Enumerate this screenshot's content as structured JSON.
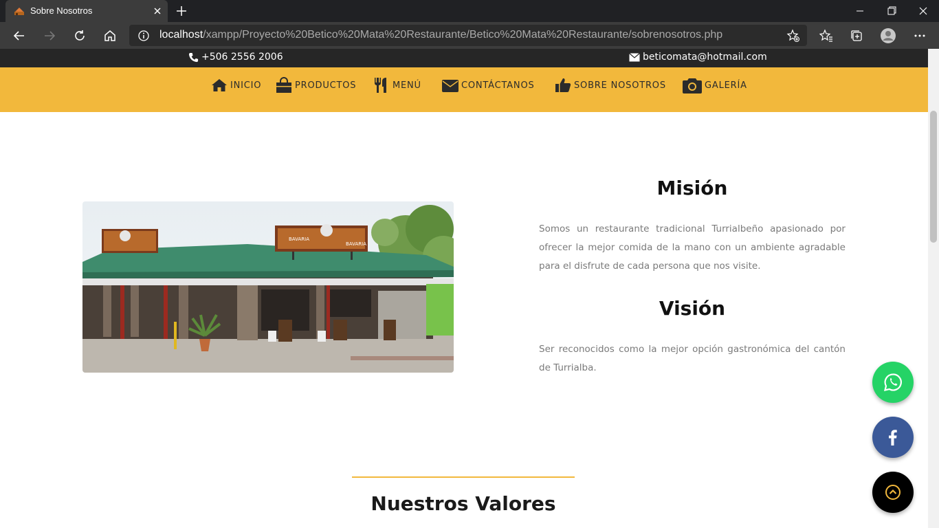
{
  "browser": {
    "tab_title": "Sobre Nosotros",
    "url_host": "localhost",
    "url_path": "/xampp/Proyecto%20Betico%20Mata%20Restaurante/Betico%20Mata%20Restaurante/sobrenosotros.php"
  },
  "topinfo": {
    "phone": "+506 2556 2006",
    "email": "beticomata@hotmail.com"
  },
  "nav": {
    "items": [
      {
        "label": "INICIO",
        "icon": "home-icon"
      },
      {
        "label": "PRODUCTOS",
        "icon": "shopping-bag-icon"
      },
      {
        "label": "MENÚ",
        "icon": "utensils-icon"
      },
      {
        "label": "CONTÁCTANOS",
        "icon": "envelope-icon"
      },
      {
        "label": "SOBRE NOSOTROS",
        "icon": "thumbs-up-icon"
      },
      {
        "label": "GALERÍA",
        "icon": "camera-icon"
      }
    ]
  },
  "mision": {
    "title": "Misión",
    "text": "Somos un restaurante tradicional Turrialbeño apasionado por ofrecer la mejor comida de la mano con un ambiente agradable para el disfrute de cada persona que nos visite."
  },
  "vision": {
    "title": "Visión",
    "text": "Ser reconocidos como la mejor opción gastronómica del cantón de Turrialba."
  },
  "valores": {
    "title": "Nuestros Valores"
  },
  "photo": {
    "sign_text": "BAVARIA"
  },
  "colors": {
    "accent": "#f2b83c",
    "topbar": "#262626",
    "whatsapp": "#25d366",
    "facebook": "#3b5998"
  }
}
